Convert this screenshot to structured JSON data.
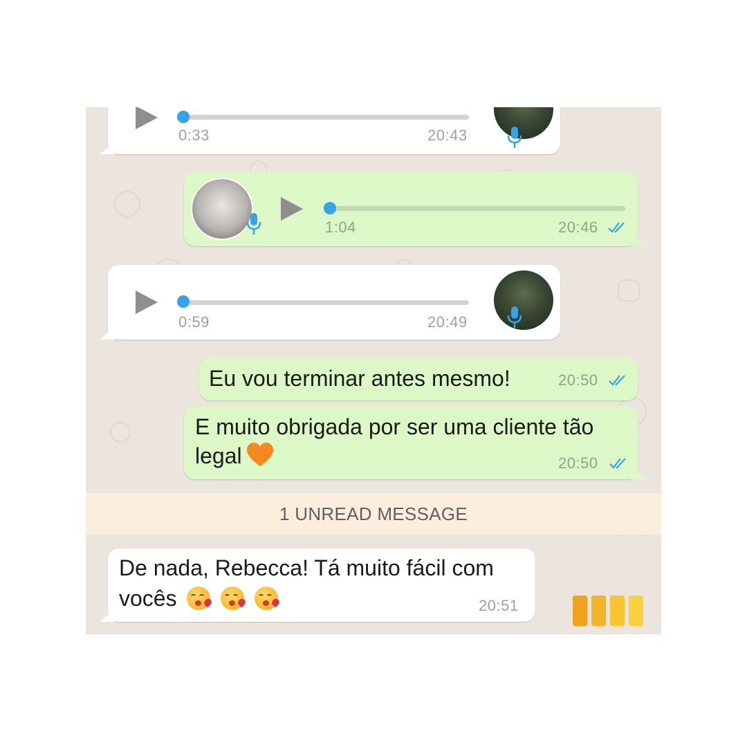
{
  "messages": [
    {
      "type": "voice",
      "direction": "in",
      "duration": "0:33",
      "time": "20:43",
      "progress": 0
    },
    {
      "type": "voice",
      "direction": "out",
      "duration": "1:04",
      "time": "20:46",
      "progress": 0,
      "read": true
    },
    {
      "type": "voice",
      "direction": "in",
      "duration": "0:59",
      "time": "20:49",
      "progress": 0
    },
    {
      "type": "text",
      "direction": "out",
      "text": "Eu vou terminar antes mesmo!",
      "time": "20:50",
      "read": true
    },
    {
      "type": "text",
      "direction": "out",
      "text": "E muito obrigada por ser uma cliente tão",
      "text_line2": "legal",
      "emoji": [
        "orange-heart"
      ],
      "time": "20:50",
      "read": true
    },
    {
      "type": "text",
      "direction": "in",
      "text": "De nada, Rebecca! Tá muito fácil com",
      "text_line2": "vocês",
      "emoji": [
        "kissing-heart",
        "kissing-heart",
        "kissing-heart"
      ],
      "time": "20:51"
    }
  ],
  "unread_banner": "1 UNREAD MESSAGE",
  "icons": {
    "play": "play-icon",
    "mic": "microphone-icon",
    "read_receipt": "double-check-icon",
    "heart": "orange-heart-emoji",
    "kiss": "face-blowing-kiss-emoji",
    "bars": "orange-bars-logo"
  },
  "colors": {
    "wallpaper": "#ece5dd",
    "incoming": "#ffffff",
    "outgoing": "#dcf8c6",
    "accent_blue": "#33a4ea",
    "unread_banner": "#fbeedc",
    "bars": [
      "#f0a21a",
      "#f6b526",
      "#f8c531",
      "#fad23f"
    ]
  }
}
